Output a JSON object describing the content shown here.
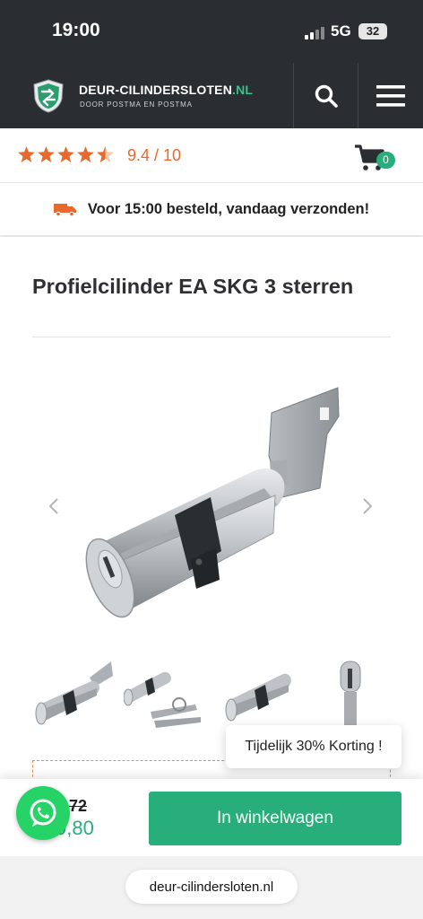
{
  "status_bar": {
    "time": "19:00",
    "network": "5G",
    "battery": "32"
  },
  "header": {
    "brand_name": "DEUR-CILINDERSLOTEN",
    "brand_tld": ".NL",
    "tagline": "DOOR POSTMA EN POSTMA",
    "icons": [
      "search-icon",
      "menu-icon"
    ]
  },
  "rating": {
    "stars": 4.5,
    "score_text": "9.4 / 10",
    "color": "#e9682b"
  },
  "cart": {
    "count": "0",
    "icon": "cart-icon"
  },
  "shipping": {
    "text": "Voor 15:00 besteld, vandaag verzonden!",
    "icon": "truck-icon"
  },
  "product": {
    "title": "Profielcilinder EA SKG 3 sterren",
    "gallery_icons": [
      "chevron-left-icon",
      "chevron-right-icon"
    ],
    "thumbnails": 4,
    "discount_popup": "Tijdelijk 30% Korting !"
  },
  "buy": {
    "old_price": "72",
    "new_price": "9,80",
    "button_label": "In winkelwagen",
    "accent": "#27ae7a"
  },
  "browser": {
    "url": "deur-cilindersloten.nl"
  }
}
